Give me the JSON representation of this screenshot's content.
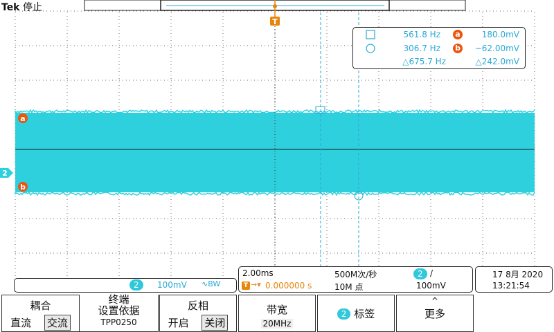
{
  "header": {
    "brand": "Tek",
    "status": "停止",
    "trigger_marker": "T"
  },
  "cursor_readout": {
    "cursor_a_freq": "561.8 Hz",
    "cursor_a_label": "a",
    "cursor_a_value": "180.0mV",
    "cursor_b_freq": "306.7 Hz",
    "cursor_b_label": "b",
    "cursor_b_value": "−62.00mV",
    "delta_freq": "△675.7 Hz",
    "delta_value": "△242.0mV"
  },
  "waveform": {
    "channel_marker": "2",
    "cursor_a_marker": "a",
    "cursor_b_marker": "b",
    "color": "#2fd0de"
  },
  "channel_bar": {
    "channel": "2",
    "scale": "100mV",
    "bandwidth_symbol": "∿BW"
  },
  "timebase": {
    "horizontal_scale": "2.00ms",
    "sample_rate": "500M次/秒",
    "trigger_channel": "2",
    "trigger_slope": "/",
    "trigger_position": "0.000000 s",
    "record_length": "10M 点",
    "trigger_level": "100mV"
  },
  "datetime": {
    "date": "17 8月 2020",
    "time": "13:21:54"
  },
  "menu": {
    "coupling_title": "耦合",
    "coupling_dc": "直流",
    "coupling_ac": "交流",
    "termination_title_1": "终端",
    "termination_title_2": "设置依据",
    "termination_value": "TPP0250",
    "invert_title": "反相",
    "invert_on": "开启",
    "invert_off": "关闭",
    "bandwidth_title": "带宽",
    "bandwidth_value": "20MHz",
    "label_channel": "2",
    "label_text": "标签",
    "more_text": "更多",
    "more_arrow": "^"
  },
  "colors": {
    "waveform": "#2fd0de",
    "cursor": "#29a9d6",
    "trigger": "#e8860c",
    "cursor_badge": "#e8560f"
  }
}
